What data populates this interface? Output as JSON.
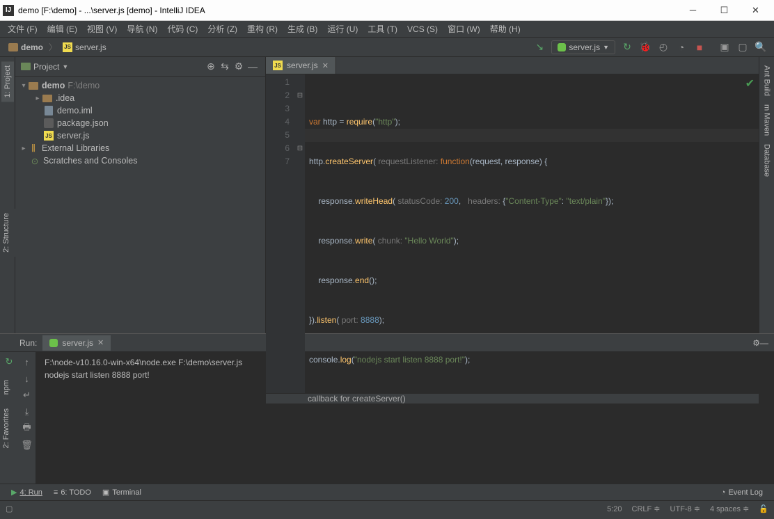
{
  "window": {
    "title": "demo [F:\\demo] - ...\\server.js [demo] - IntelliJ IDEA"
  },
  "menu": [
    "文件 (F)",
    "编辑 (E)",
    "视图 (V)",
    "导航 (N)",
    "代码 (C)",
    "分析 (Z)",
    "重构 (R)",
    "生成 (B)",
    "运行 (U)",
    "工具 (T)",
    "VCS (S)",
    "窗口 (W)",
    "帮助 (H)"
  ],
  "breadcrumb": {
    "root": "demo",
    "file": "server.js"
  },
  "runConfig": "server.js",
  "projectPanel": {
    "title": "Project",
    "tree": {
      "root": {
        "name": "demo",
        "path": "F:\\demo"
      },
      "idea": ".idea",
      "demoIml": "demo.iml",
      "packageJson": "package.json",
      "serverJs": "server.js",
      "extLibs": "External Libraries",
      "scratches": "Scratches and Consoles"
    }
  },
  "sideTabs": {
    "left": [
      "1: Project",
      "2: Structure",
      "npm",
      "2: Favorites"
    ],
    "right": [
      "Ant Build",
      "m Maven",
      "Database"
    ]
  },
  "editor": {
    "tab": "server.js",
    "hint": "callback for createServer()",
    "lineNumbers": [
      "1",
      "2",
      "3",
      "4",
      "5",
      "6",
      "7"
    ]
  },
  "code": {
    "l1": {
      "a": "var",
      "b": " http = ",
      "c": "require",
      "d": "(",
      "e": "\"http\"",
      "f": ");"
    },
    "l2": {
      "a": "http.",
      "b": "createServer",
      "c": "(",
      "h1": " requestListener: ",
      "d": "function",
      "e": "(request, response) {"
    },
    "l3": {
      "a": "    response.",
      "b": "writeHead",
      "c": "(",
      "h1": " statusCode: ",
      "n": "200",
      "d": ",",
      "h2": "   headers: ",
      "e": "{",
      "s1": "\"Content-Type\"",
      "f": ": ",
      "s2": "\"text/plain\"",
      "g": "});"
    },
    "l4": {
      "a": "    response.",
      "b": "write",
      "c": "(",
      "h1": " chunk: ",
      "s": "\"Hello World\"",
      "d": ");"
    },
    "l5": {
      "a": "    response.",
      "b": "end",
      "c": "();"
    },
    "l6": {
      "a": "}).",
      "b": "listen",
      "c": "(",
      "h1": " port: ",
      "n": "8888",
      "d": ");"
    },
    "l7": {
      "a": "console.",
      "b": "log",
      "c": "(",
      "s": "\"nodejs start listen 8888 port!\"",
      "d": ");"
    }
  },
  "runPanel": {
    "title": "Run:",
    "tab": "server.js",
    "console": {
      "l1": "F:\\node-v10.16.0-win-x64\\node.exe F:\\demo\\server.js",
      "l2": "nodejs start listen 8888 port!"
    }
  },
  "bottomBar": {
    "run": "4: Run",
    "todo": "6: TODO",
    "terminal": "Terminal",
    "eventLog": "Event Log"
  },
  "statusBar": {
    "pos": "5:20",
    "lineSep": "CRLF",
    "enc": "UTF-8",
    "indent": "4 spaces"
  }
}
